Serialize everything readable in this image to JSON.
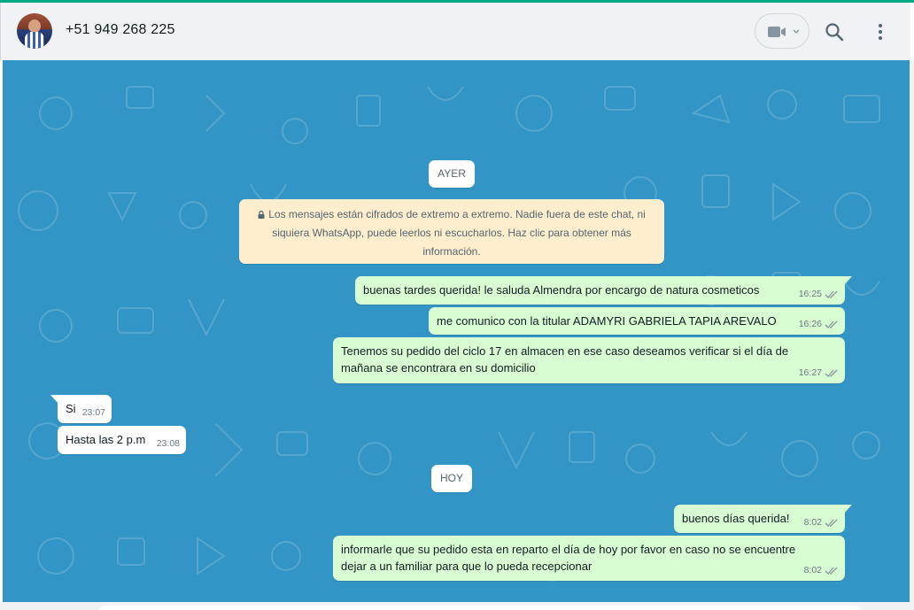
{
  "header": {
    "contact_name": "+51 949 268 225",
    "icons": [
      "avatar",
      "video-call-icon",
      "chevron-down-icon",
      "search-icon",
      "kebab-menu-icon"
    ]
  },
  "colors": {
    "accent": "#00a884",
    "chat_background": "#3395c5",
    "outgoing_bubble": "#d9fdd3",
    "incoming_bubble": "#ffffff",
    "encryption_notice": "#ffeecd",
    "read_ticks": "#8696a0"
  },
  "chat": {
    "date_yesterday": "AYER",
    "date_today": "HOY",
    "encryption_notice": "Los mensajes están cifrados de extremo a extremo. Nadie fuera de este chat, ni siquiera WhatsApp, puede leerlos ni escucharlos. Haz clic para obtener más información.",
    "messages": [
      {
        "direction": "out",
        "text": "buenas tardes querida! le saluda Almendra por encargo de natura cosmeticos",
        "time": "16:25",
        "status": "read"
      },
      {
        "direction": "out",
        "text": "me comunico con la titular ADAMYRI GABRIELA TAPIA AREVALO",
        "time": "16:26",
        "status": "read"
      },
      {
        "direction": "out",
        "text": "Tenemos su pedido del ciclo 17 en almacen en ese caso deseamos verificar si el día de mañana se encontrara en su domicilio",
        "time": "16:27",
        "status": "read"
      },
      {
        "direction": "in",
        "text": "Si",
        "time": "23:07"
      },
      {
        "direction": "in",
        "text": "Hasta las 2 p.m",
        "time": "23:08"
      },
      {
        "direction": "out",
        "text": "buenos días querida!",
        "time": "8:02",
        "status": "read"
      },
      {
        "direction": "out",
        "text": "informarle que su pedido esta en reparto el día de hoy por favor en caso no se encuentre dejar a un familiar para que lo pueda recepcionar",
        "time": "8:02",
        "status": "read"
      }
    ]
  }
}
